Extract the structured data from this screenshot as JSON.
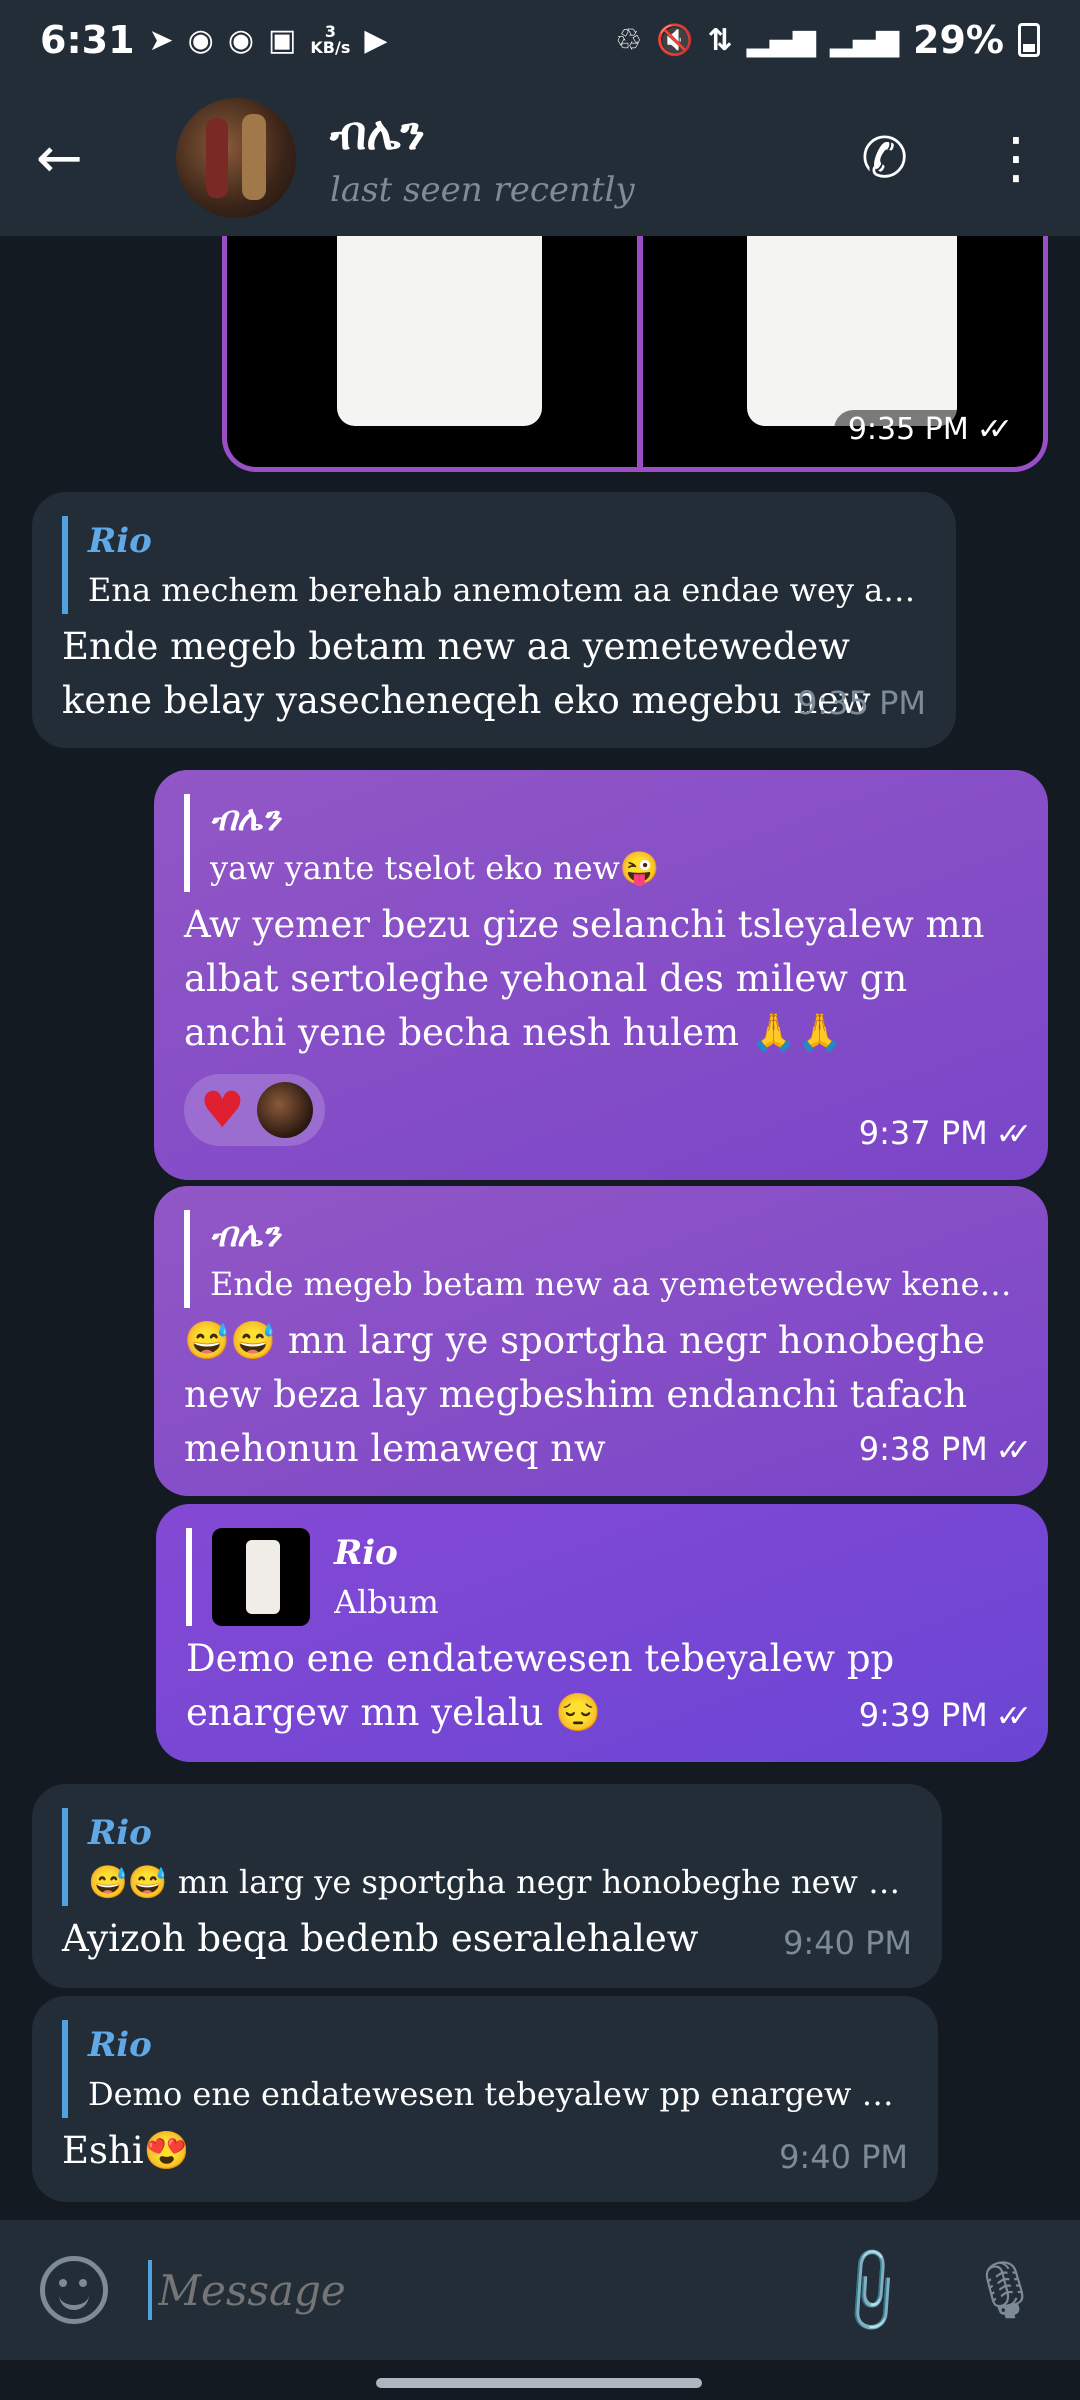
{
  "status_bar": {
    "time": "6:31",
    "speed_value": "3",
    "speed_unit": "KB/s",
    "battery": "29%"
  },
  "header": {
    "title": "ብሌን",
    "subtitle": "last seen recently"
  },
  "album": {
    "time": "9:35 PM"
  },
  "messages": [
    {
      "reply_name": "Rio",
      "reply_text": "Ena mechem berehab anemotem aa endae wey abren e...",
      "text": "Ende megeb betam new aa yemetewedew kene belay yasecheneqeh eko megebu new",
      "time": "9:35 PM"
    },
    {
      "reply_name": "ብሌን",
      "reply_text": "yaw yante tselot eko new😜",
      "text": "Aw yemer bezu gize selanchi tsleyalew mn albat sertoleghe yehonal des milew gn anchi yene becha nesh hulem 🙏🙏",
      "time": "9:37 PM"
    },
    {
      "reply_name": "ብሌን",
      "reply_text": "Ende megeb betam new aa yemetewedew kene belay y...",
      "text": "😅😅 mn larg ye sportgha negr honobeghe new beza lay megbeshim endanchi tafach mehonun lemaweq nw",
      "time": "9:38 PM"
    },
    {
      "reply_name": "Rio",
      "reply_text": "Album",
      "text": "Demo ene endatewesen tebeyalew pp enargew mn yelalu 😔",
      "time": "9:39 PM"
    },
    {
      "reply_name": "Rio",
      "reply_text": "😅😅 mn larg ye sportgha negr honobeghe new beza l...",
      "text": "Ayizoh beqa bedenb eseralehalew",
      "time": "9:40 PM"
    },
    {
      "reply_name": "Rio",
      "reply_text": "Demo ene endatewesen tebeyalew pp enargew mn yela...",
      "text": "Eshi😍",
      "time": "9:40 PM"
    }
  ],
  "input": {
    "placeholder": "Message"
  }
}
